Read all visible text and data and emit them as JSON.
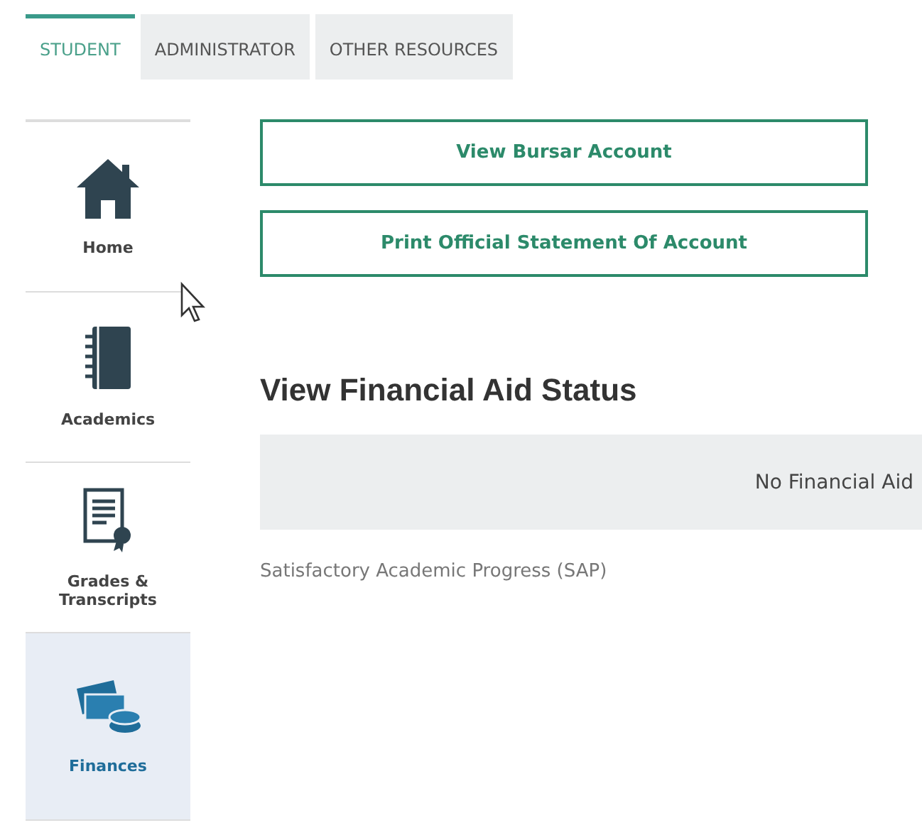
{
  "tabs": [
    {
      "label": "STUDENT",
      "selected": true
    },
    {
      "label": "ADMINISTRATOR",
      "selected": false
    },
    {
      "label": "OTHER RESOURCES",
      "selected": false
    }
  ],
  "sidebar": {
    "items": [
      {
        "label": "Home",
        "kind": "home",
        "selected": false
      },
      {
        "label": "Academics",
        "kind": "notebook",
        "selected": false
      },
      {
        "label": "Grades & Transcripts",
        "kind": "certificate",
        "selected": false
      },
      {
        "label": "Finances",
        "kind": "money",
        "selected": true
      }
    ]
  },
  "buttons": [
    "View Bursar Account",
    "Print Official Statement Of Account"
  ],
  "financial_aid": {
    "heading": "View Financial Aid Status",
    "status": "No Financial Aid",
    "link": "Satisfactory Academic Progress (SAP)"
  }
}
